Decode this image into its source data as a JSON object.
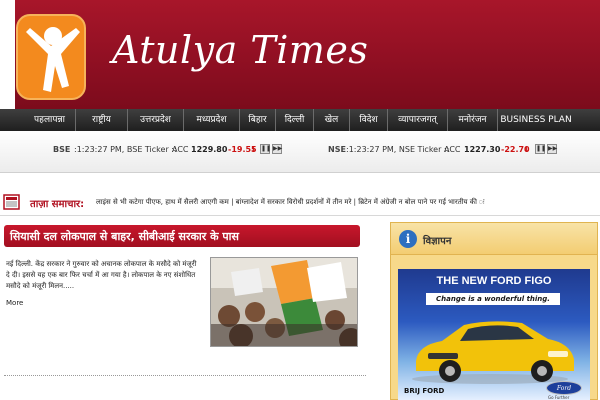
{
  "brand": {
    "title": "Atulya Times",
    "logo_icon": "person-jumping-icon",
    "logo_color": "#f38a1e",
    "band_color": "#8e0f22"
  },
  "nav": {
    "items": [
      {
        "label": "पहलापन्ना"
      },
      {
        "label": "राष्ट्रीय"
      },
      {
        "label": "उत्तरप्रदेश"
      },
      {
        "label": "मध्यप्रदेश"
      },
      {
        "label": "बिहार"
      },
      {
        "label": "दिल्ली"
      },
      {
        "label": "खेल"
      },
      {
        "label": "विदेश"
      },
      {
        "label": "व्यापारजगत्"
      },
      {
        "label": "मनोरंजन"
      },
      {
        "label": "BUSINESS PLAN"
      }
    ]
  },
  "ticker": {
    "bse": {
      "label": "BSE",
      "time": ":1:23:27 PM, BSE Ticker ::",
      "symbol": "ACC",
      "price": "1229.80",
      "change": "-19.55"
    },
    "nse": {
      "label": "NSE",
      "time": ":1:23:27 PM, NSE Ticker ::",
      "symbol": "ACC",
      "price": "1227.30",
      "change": "-22.70"
    },
    "down_color": "#cc1111"
  },
  "breaking": {
    "label": "ताज़ा समाचार:",
    "text": "लाइंस से भी कटेगा पीएफ, हाथ में सैलरी आएगी कम  |  बांग्लादेश में सरकार विरोधी प्रदर्शनों में तीन मरे  |  ब्रिटेन में अंग्रेजी न बोल पाने पर गई भारतीय की ः"
  },
  "story": {
    "title": "सियासी दल लोकपाल से बाहर, सीबीआई सरकार के पास",
    "body": "नई दिल्ली. केंद्र सरकार ने गुरुवार को अचानक लोकपाल के मसौदे को मंजूरी दे दी। इससे यह एक बार फिर चर्चा में आ गया है। लोकपाल के नए संशोधित मसौदे को मंजूरी मिलन.....",
    "more": "More"
  },
  "ad": {
    "title": "विज्ञापन",
    "headline": "THE NEW FORD FIGO",
    "tagline": "Change is a wonderful thing.",
    "dealer": "BRIJ FORD",
    "brand": "Ford",
    "brand_tag": "Go Further"
  }
}
